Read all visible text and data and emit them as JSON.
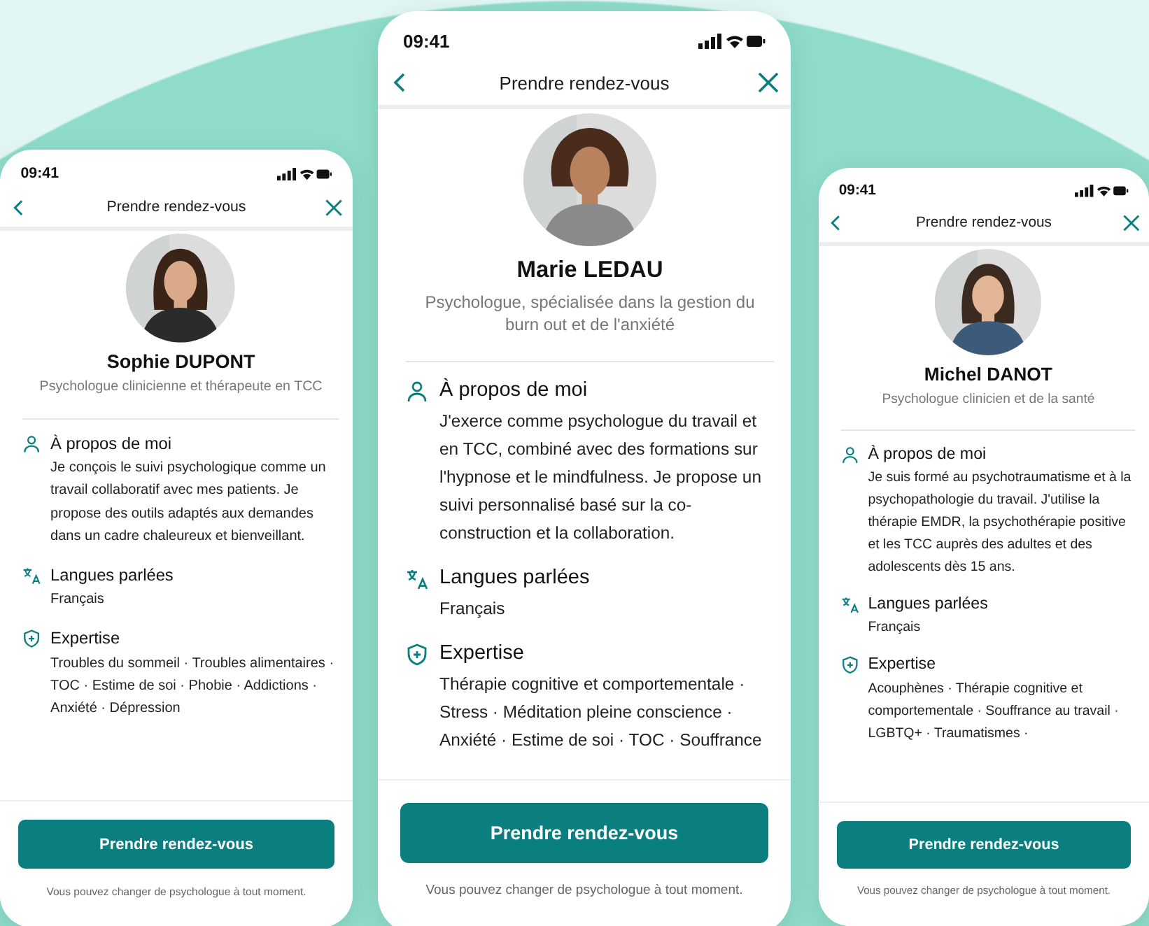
{
  "phones": [
    {
      "status_time": "09:41",
      "header_title": "Prendre rendez-vous",
      "name": "Sophie DUPONT",
      "subtitle": "Psychologue clinicienne et thérapeute en TCC",
      "sections": [
        {
          "kind": "about",
          "title": "À propos de moi",
          "text": "Je conçois le suivi psychologique comme un travail collaboratif avec mes patients. Je propose des outils adaptés aux demandes dans un cadre chaleureux et bienveillant."
        },
        {
          "kind": "languages",
          "title": "Langues parlées",
          "text": "Français"
        },
        {
          "kind": "expertise",
          "title": "Expertise",
          "text": "Troubles du sommeil · Troubles alimentaires · TOC · Estime de soi · Phobie · Addictions · Anxiété · Dépression"
        }
      ],
      "button": "Prendre rendez-vous",
      "note": "Vous pouvez changer de psychologue à tout moment."
    },
    {
      "status_time": "09:41",
      "header_title": "Prendre rendez-vous",
      "name": "Marie LEDAU",
      "subtitle": "Psychologue, spécialisée dans la gestion du burn out et de l'anxiété",
      "sections": [
        {
          "kind": "about",
          "title": "À propos de moi",
          "text": "J'exerce comme psychologue du travail et en TCC, combiné avec des formations sur l'hypnose et le mindfulness. Je propose un suivi personnalisé basé sur la co-construction et la collaboration."
        },
        {
          "kind": "languages",
          "title": "Langues parlées",
          "text": "Français"
        },
        {
          "kind": "expertise",
          "title": "Expertise",
          "text": "Thérapie cognitive et comportementale · Stress · Méditation pleine conscience · Anxiété · Estime de soi · TOC · Souffrance"
        }
      ],
      "button": "Prendre rendez-vous",
      "note": "Vous pouvez changer de psychologue à tout moment."
    },
    {
      "status_time": "09:41",
      "header_title": "Prendre rendez-vous",
      "name": "Michel DANOT",
      "subtitle": "Psychologue clinicien et de la santé",
      "sections": [
        {
          "kind": "about",
          "title": "À propos de moi",
          "text": "Je suis formé au psychotraumatisme et à la psychopathologie du travail. J'utilise la thérapie EMDR, la psychothérapie positive et les TCC auprès des adultes et des adolescents dès 15 ans."
        },
        {
          "kind": "languages",
          "title": "Langues parlées",
          "text": "Français"
        },
        {
          "kind": "expertise",
          "title": "Expertise",
          "text": "Acouphènes · Thérapie cognitive et comportementale · Souffrance au travail · LGBTQ+ · Traumatismes ·"
        }
      ],
      "button": "Prendre rendez-vous",
      "note": "Vous pouvez changer de psychologue à tout moment."
    }
  ]
}
